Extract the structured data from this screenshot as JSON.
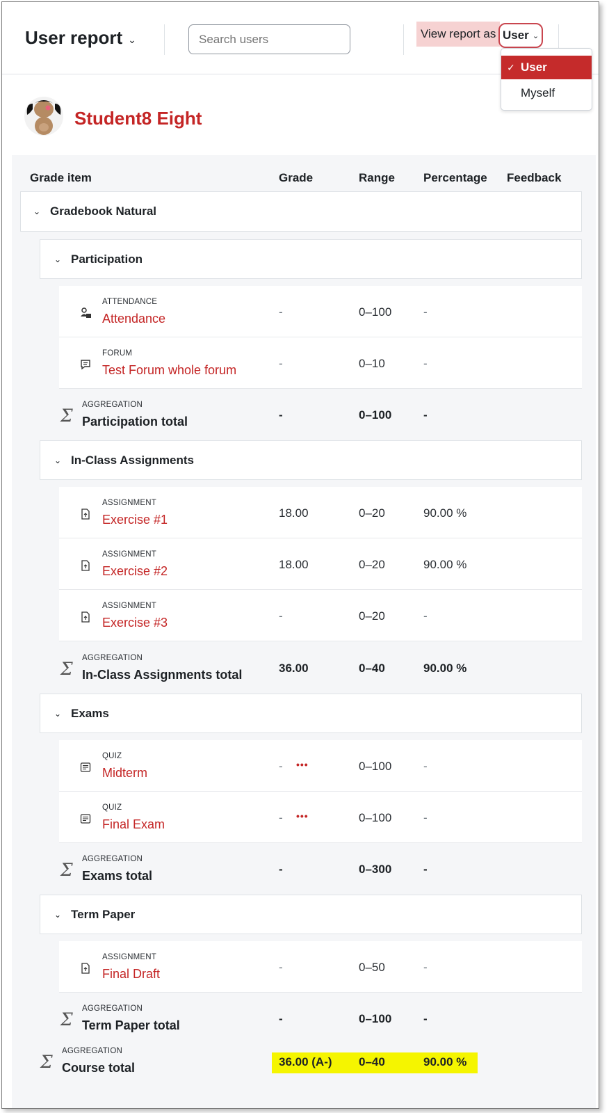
{
  "header": {
    "title": "User report",
    "search_placeholder": "Search users",
    "view_report_label": "View report as",
    "view_report_value": "User",
    "dropdown": {
      "options": [
        "User",
        "Myself"
      ],
      "selected": "User"
    }
  },
  "user": {
    "name": "Student8 Eight"
  },
  "columns": {
    "item": "Grade item",
    "grade": "Grade",
    "range": "Range",
    "percentage": "Percentage",
    "feedback": "Feedback"
  },
  "course": {
    "name": "Gradebook Natural"
  },
  "categories": [
    {
      "name": "Participation",
      "items": [
        {
          "type": "ATTENDANCE",
          "name": "Attendance",
          "grade": "-",
          "range": "0–100",
          "percentage": "-",
          "icon": "attendance-icon"
        },
        {
          "type": "FORUM",
          "name": "Test Forum whole forum",
          "grade": "-",
          "range": "0–10",
          "percentage": "-",
          "icon": "forum-icon"
        }
      ],
      "total": {
        "type": "AGGREGATION",
        "name": "Participation total",
        "grade": "-",
        "range": "0–100",
        "percentage": "-"
      }
    },
    {
      "name": "In-Class Assignments",
      "items": [
        {
          "type": "ASSIGNMENT",
          "name": "Exercise #1",
          "grade": "18.00",
          "range": "0–20",
          "percentage": "90.00 %",
          "icon": "assignment-icon"
        },
        {
          "type": "ASSIGNMENT",
          "name": "Exercise #2",
          "grade": "18.00",
          "range": "0–20",
          "percentage": "90.00 %",
          "icon": "assignment-icon"
        },
        {
          "type": "ASSIGNMENT",
          "name": "Exercise #3",
          "grade": "-",
          "range": "0–20",
          "percentage": "-",
          "icon": "assignment-icon"
        }
      ],
      "total": {
        "type": "AGGREGATION",
        "name": "In-Class Assignments total",
        "grade": "36.00",
        "range": "0–40",
        "percentage": "90.00 %"
      }
    },
    {
      "name": "Exams",
      "items": [
        {
          "type": "QUIZ",
          "name": "Midterm",
          "grade": "-",
          "range": "0–100",
          "percentage": "-",
          "icon": "quiz-icon",
          "actions": "•••"
        },
        {
          "type": "QUIZ",
          "name": "Final Exam",
          "grade": "-",
          "range": "0–100",
          "percentage": "-",
          "icon": "quiz-icon",
          "actions": "•••"
        }
      ],
      "total": {
        "type": "AGGREGATION",
        "name": "Exams total",
        "grade": "-",
        "range": "0–300",
        "percentage": "-"
      }
    },
    {
      "name": "Term Paper",
      "items": [
        {
          "type": "ASSIGNMENT",
          "name": "Final Draft",
          "grade": "-",
          "range": "0–50",
          "percentage": "-",
          "icon": "assignment-icon"
        }
      ],
      "total": {
        "type": "AGGREGATION",
        "name": "Term Paper total",
        "grade": "-",
        "range": "0–100",
        "percentage": "-"
      }
    }
  ],
  "course_total": {
    "type": "AGGREGATION",
    "name": "Course total",
    "grade": "36.00 (A-)",
    "range": "0–40",
    "percentage": "90.00 %"
  },
  "colors": {
    "link": "#c42525",
    "highlight": "#f5f500",
    "active_dropdown": "#c52b2b"
  }
}
